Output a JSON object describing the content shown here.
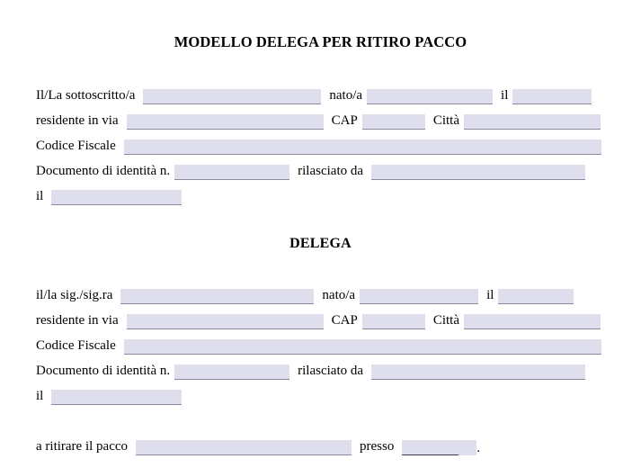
{
  "document": {
    "title": "MODELLO DELEGA PER RITIRO PACCO",
    "section_title": "DELEGA"
  },
  "colors": {
    "field_fill": "#dedeed",
    "field_rule": "#8a8aa2",
    "text": "#000000",
    "page_background": "#ffffff"
  },
  "declarant": {
    "row1": {
      "label_name": "Il/La sottoscritto/a",
      "name_value": "",
      "label_born": "nato/a",
      "born_value": "",
      "label_on": "il",
      "on_value": ""
    },
    "row2": {
      "label_address": "residente in via",
      "address_value": "",
      "label_cap": "CAP",
      "cap_value": "",
      "label_city": "Città",
      "city_value": ""
    },
    "row3": {
      "label_fiscal_code": "Codice Fiscale",
      "fiscal_code_value": ""
    },
    "row4": {
      "label_document": "Documento di identità n.",
      "document_value": "",
      "label_issued_by": "rilasciato da",
      "issued_by_value": ""
    },
    "row5": {
      "label_date": "il",
      "date_value": ""
    }
  },
  "delegate": {
    "row1": {
      "label_name": "il/la sig./sig.ra",
      "name_value": "",
      "label_born": "nato/a",
      "born_value": "",
      "label_on": "il",
      "on_value": ""
    },
    "row2": {
      "label_address": "residente in via",
      "address_value": "",
      "label_cap": "CAP",
      "cap_value": "",
      "label_city": "Città",
      "city_value": ""
    },
    "row3": {
      "label_fiscal_code": "Codice Fiscale",
      "fiscal_code_value": ""
    },
    "row4": {
      "label_document": "Documento di identità n.",
      "document_value": "",
      "label_issued_by": "rilasciato da",
      "issued_by_value": ""
    },
    "row5": {
      "label_date": "il",
      "date_value": ""
    }
  },
  "pickup": {
    "label_pickup": "a ritirare il pacco",
    "pickup_value": "",
    "label_at": "presso",
    "at_value": "",
    "terminator": "."
  }
}
